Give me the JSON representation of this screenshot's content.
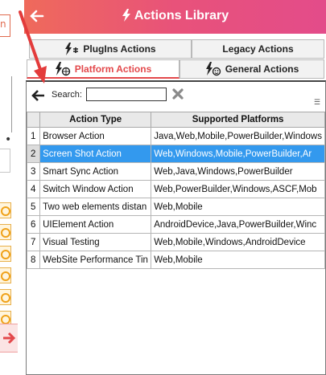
{
  "left_panel": {
    "top_box_text": "n",
    "dot_text": "•"
  },
  "header": {
    "title": "Actions Library",
    "bg_colors": [
      "#ef6a5b",
      "#e34c8a"
    ]
  },
  "tabs": {
    "row1": [
      {
        "label": "PlugIns Actions",
        "icon": "plugin-bolt-icon"
      },
      {
        "label": "Legacy Actions",
        "icon": ""
      }
    ],
    "row2": [
      {
        "label": "Platform Actions",
        "icon": "platform-bolt-icon",
        "active": true
      },
      {
        "label": "General Actions",
        "icon": "general-bolt-icon"
      }
    ],
    "active_color": "#e3484b"
  },
  "toolbar": {
    "search_label": "Search:",
    "search_value": ""
  },
  "table": {
    "columns": [
      "",
      "Action Type",
      "Supported Platforms"
    ],
    "rows": [
      {
        "num": "1",
        "type": "Browser Action",
        "platforms": "Java,Web,Mobile,PowerBuilder,Windows"
      },
      {
        "num": "2",
        "type": "Screen Shot Action",
        "platforms": "Web,Windows,Mobile,PowerBuilder,Ar",
        "selected": true
      },
      {
        "num": "3",
        "type": "Smart Sync Action",
        "platforms": "Web,Java,Windows,PowerBuilder"
      },
      {
        "num": "4",
        "type": "Switch Window Action",
        "platforms": "Web,PowerBuilder,Windows,ASCF,Mob"
      },
      {
        "num": "5",
        "type": "Two web elements distan",
        "platforms": "Web,Mobile"
      },
      {
        "num": "6",
        "type": "UIElement Action",
        "platforms": "AndroidDevice,Java,PowerBuilder,Winc"
      },
      {
        "num": "7",
        "type": "Visual Testing",
        "platforms": "Web,Mobile,Windows,AndroidDevice"
      },
      {
        "num": "8",
        "type": "WebSite Performance Tin",
        "platforms": "Web,Mobile"
      }
    ],
    "selected_color": "#3399ee"
  }
}
